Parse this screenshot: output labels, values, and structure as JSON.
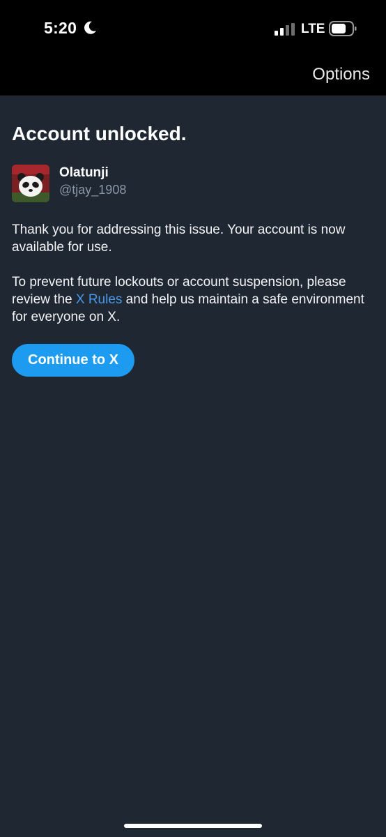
{
  "status_bar": {
    "time": "5:20",
    "network": "LTE",
    "moon_icon": "moon-icon",
    "signal_icon": "cellular-signal-icon",
    "battery_icon": "battery-icon"
  },
  "nav": {
    "options_label": "Options"
  },
  "main": {
    "title": "Account unlocked.",
    "account": {
      "display_name": "Olatunji",
      "username": "@tjay_1908",
      "avatar_icon": "panda-avatar"
    },
    "paragraph1": "Thank you for addressing this issue. Your account is now available for use.",
    "paragraph2_before": "To prevent future lockouts or account suspension, please review the ",
    "rules_link": "X Rules",
    "paragraph2_after": " and help us maintain a safe environment for everyone on X.",
    "continue_label": "Continue to X"
  },
  "colors": {
    "background": "#1e2732",
    "top_bar": "#000000",
    "accent": "#1d9bf0",
    "link": "#4a99e9",
    "secondary_text": "#8b98a5"
  }
}
